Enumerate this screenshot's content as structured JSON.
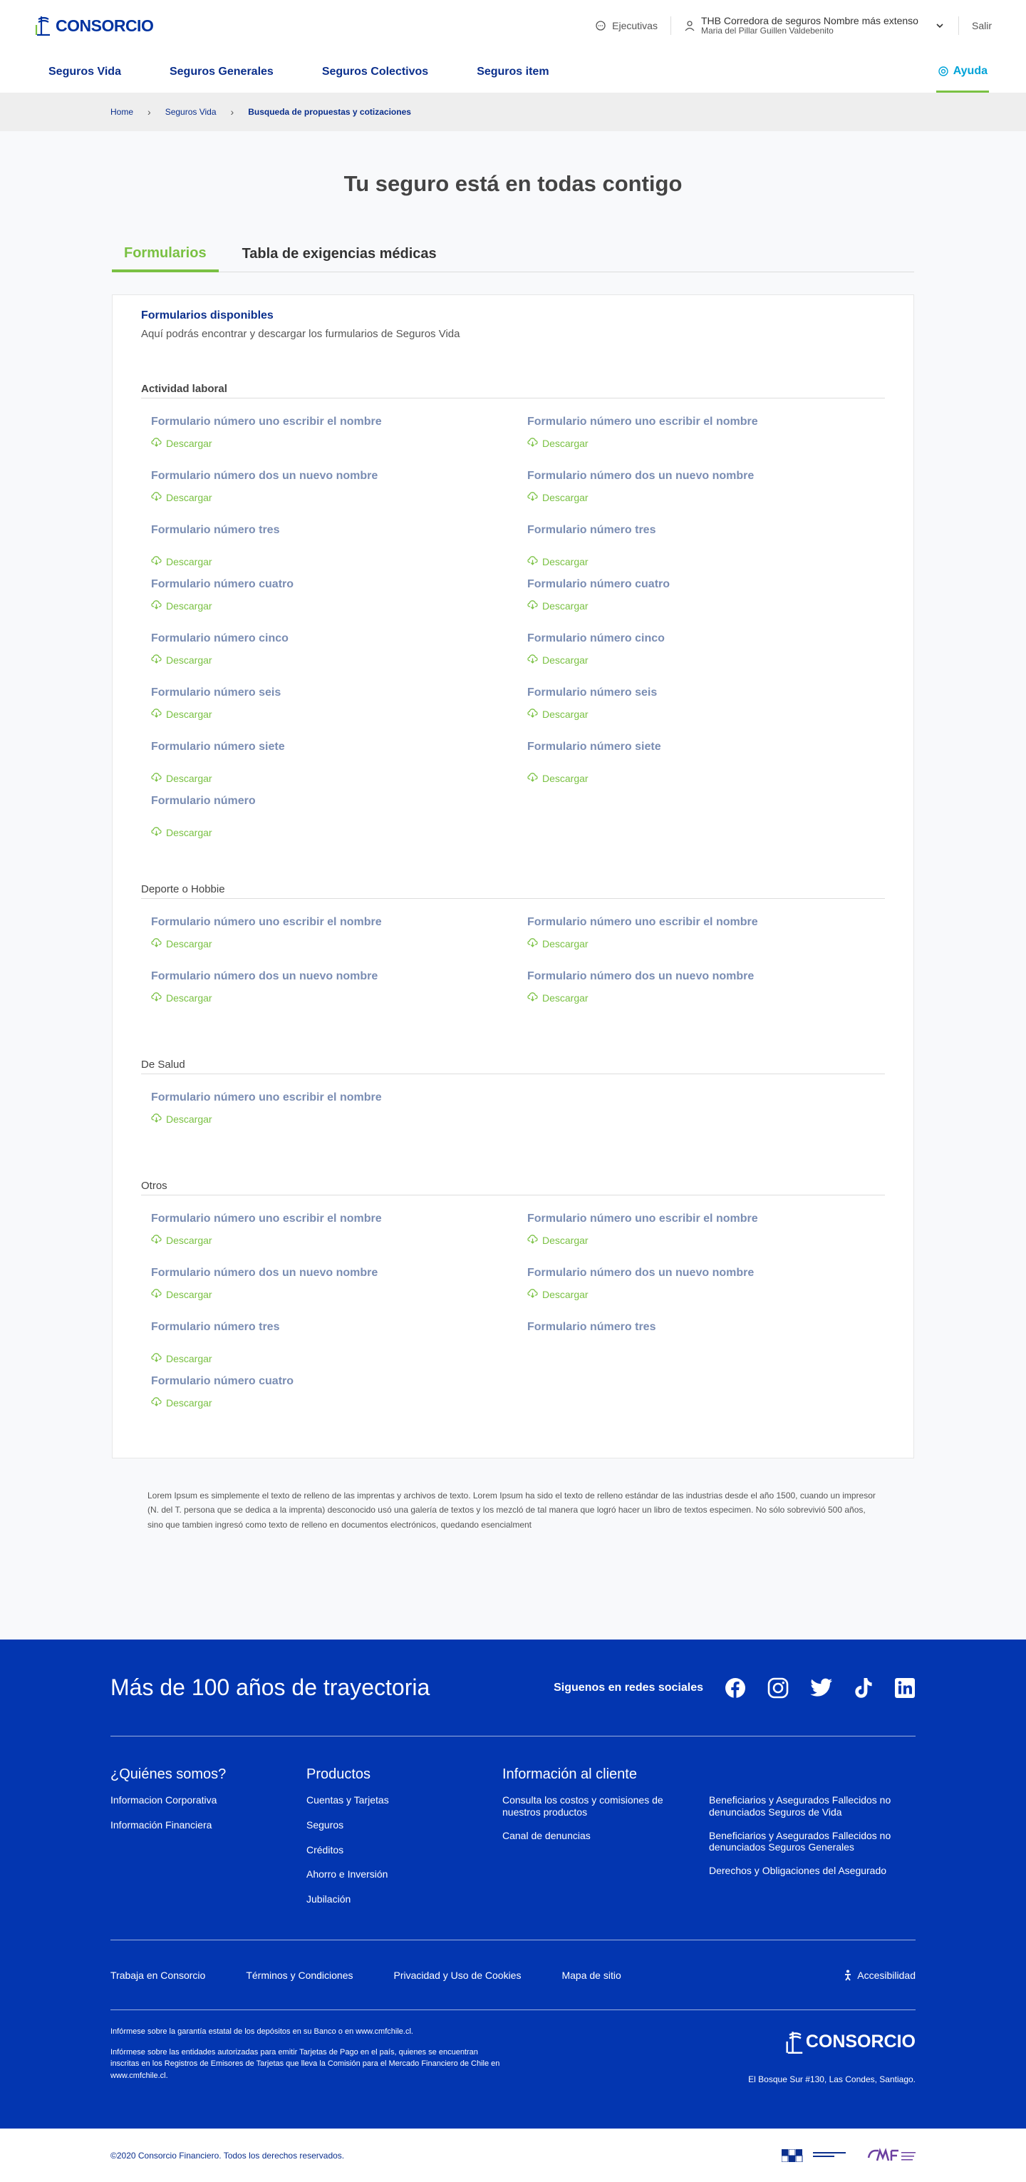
{
  "header": {
    "brand": "CONSORCIO",
    "ejecutivas": "Ejecutivas",
    "company": "THB Corredora de seguros Nombre más extenso",
    "user": "Maria del Pillar Guillen Valdebenito",
    "logout": "Salir"
  },
  "nav": {
    "items": [
      "Seguros Vida",
      "Seguros Generales",
      "Seguros Colectivos",
      "Seguros item"
    ],
    "help": "Ayuda"
  },
  "breadcrumb": [
    "Home",
    "Seguros Vida",
    "Busqueda de propuestas y cotizaciones"
  ],
  "main": {
    "title": "Tu seguro está en todas contigo",
    "tabs": [
      "Formularios",
      "Tabla de exigencias médicas"
    ],
    "card_title": "Formularios disponibles",
    "card_subtitle": "Aquí podrás encontrar y descargar los furmularios de Seguros Vida",
    "download_label": "Descargar",
    "sections": [
      {
        "title": "Actividad laboral",
        "bold": true,
        "forms": [
          {
            "name": "Formulario número uno escribir el nombre",
            "download": true
          },
          {
            "name": "Formulario número uno escribir el nombre",
            "download": true
          },
          {
            "name": "Formulario número dos un nuevo nombre",
            "download": true
          },
          {
            "name": "Formulario número dos un nuevo nombre",
            "download": true
          },
          {
            "name": "Formulario número tres",
            "download": true,
            "low": true
          },
          {
            "name": "Formulario número tres",
            "download": true,
            "low": true
          },
          {
            "name": "Formulario número cuatro",
            "download": true
          },
          {
            "name": "Formulario número cuatro",
            "download": true
          },
          {
            "name": "Formulario número cinco",
            "download": true
          },
          {
            "name": "Formulario número cinco",
            "download": true
          },
          {
            "name": "Formulario número seis",
            "download": true
          },
          {
            "name": "Formulario número seis",
            "download": true
          },
          {
            "name": "Formulario número siete",
            "download": true,
            "low": true
          },
          {
            "name": "Formulario número siete",
            "download": true,
            "low": true
          },
          {
            "name": "Formulario número",
            "download": true,
            "low": true
          }
        ]
      },
      {
        "title": "Deporte o Hobbie",
        "bold": false,
        "forms": [
          {
            "name": "Formulario número uno escribir el nombre",
            "download": true
          },
          {
            "name": "Formulario número uno escribir el nombre",
            "download": true
          },
          {
            "name": "Formulario número dos un nuevo nombre",
            "download": true
          },
          {
            "name": "Formulario número dos un nuevo nombre",
            "download": true
          }
        ]
      },
      {
        "title": "De Salud",
        "bold": false,
        "forms": [
          {
            "name": "Formulario número uno escribir el nombre",
            "download": true
          }
        ]
      },
      {
        "title": "Otros",
        "bold": false,
        "forms": [
          {
            "name": "Formulario número uno escribir el nombre",
            "download": true
          },
          {
            "name": "Formulario número uno escribir el nombre",
            "download": true
          },
          {
            "name": "Formulario número dos un nuevo nombre",
            "download": true
          },
          {
            "name": "Formulario número dos un nuevo nombre",
            "download": true
          },
          {
            "name": "Formulario número tres",
            "download": true,
            "low": true
          },
          {
            "name": "Formulario número tres",
            "download": false
          },
          {
            "name": "Formulario número cuatro",
            "download": true
          }
        ]
      }
    ]
  },
  "legal": "Lorem Ipsum es simplemente el texto de relleno de las imprentas y archivos de texto. Lorem Ipsum ha sido el texto de relleno estándar de las industrias desde el año 1500, cuando un impresor (N. del T. persona que se dedica a la imprenta) desconocido usó una galería de textos y los mezcló de tal manera que logró hacer un libro de textos especimen. No sólo sobrevivió 500 años, sino que tambien ingresó como texto de relleno en documentos electrónicos, quedando esencialment",
  "footer": {
    "headline": "Más de 100 años de trayectoria",
    "social_label": "Siguenos en redes sociales",
    "social_icons": [
      "facebook-icon",
      "instagram-icon",
      "twitter-icon",
      "tiktok-icon",
      "linkedin-icon"
    ],
    "quienes": {
      "title": "¿Quiénes somos?",
      "links": [
        "Informacion Corporativa",
        "Información Financiera"
      ]
    },
    "productos": {
      "title": "Productos",
      "links": [
        "Cuentas y Tarjetas",
        "Seguros",
        "Créditos",
        "Ahorro e Inversión",
        "Jubilación"
      ]
    },
    "info": {
      "title": "Información al cliente",
      "links": [
        "Consulta los costos y comisiones de nuestros productos",
        "Beneficiarios y Asegurados Fallecidos no denunciados Seguros de Vida",
        "Canal de denuncias",
        "Beneficiarios y Asegurados Fallecidos no denunciados Seguros Generales",
        "",
        "Derechos y Obligaciones del Asegurado"
      ]
    },
    "bottom_links": [
      "Trabaja en Consorcio",
      "Términos y Condiciones",
      "Privacidad y Uso de Cookies",
      "Mapa de sitio"
    ],
    "accessibility": "Accesibilidad",
    "notice1": "Infórmese sobre la garantía estatal de los depósitos en su Banco o en www.cmfchile.cl.",
    "notice2": "Infórmese sobre las entidades autorizadas para emitir Tarjetas de Pago en el país, quienes se encuentran inscritas en los Registros de Emisores de Tarjetas que lleva la Comisión para el Mercado Financiero de Chile en www.cmfchile.cl.",
    "brand": "CONSORCIO",
    "address": "El Bosque Sur #130, Las Condes, Santiago."
  },
  "copyright": "©2020 Consorcio Financiero.  Todos los derechos reservados.",
  "colors": {
    "brand": "#0033a0",
    "accent": "#7ac143",
    "footer": "#0336b0",
    "help": "#00a3d8"
  }
}
